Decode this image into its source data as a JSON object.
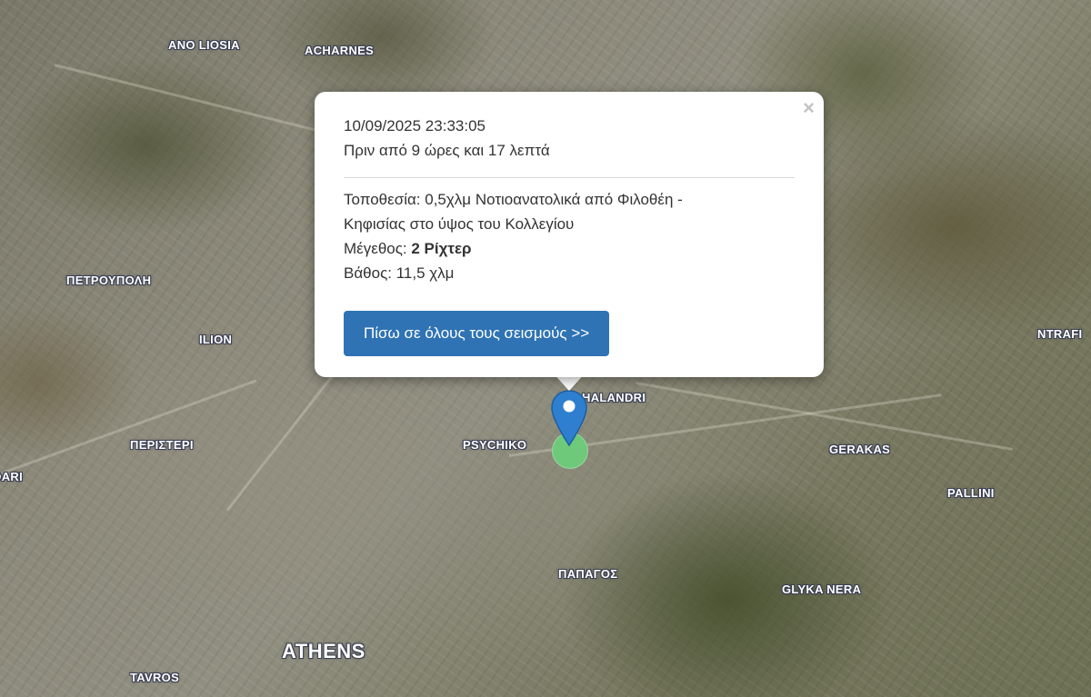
{
  "popup": {
    "datetime": "10/09/2025 23:33:05",
    "ago": "Πριν από 9 ώρες και 17 λεπτά",
    "location_line1": "Τοποθεσία: 0,5χλμ Νοτιοανατολικά από Φιλοθέη -",
    "location_line2": "Κηφισίας στο ύψος του Κολλεγίου",
    "magnitude_label": "Μέγεθος: ",
    "magnitude_value": "2 Ρίχτερ",
    "depth": "Βάθος: 11,5 χλμ",
    "back_button": "Πίσω σε όλους τους σεισμούς >>",
    "close": "×"
  },
  "map": {
    "places": [
      "ANO LIOSIA",
      "ACHARNES",
      "ΠΕΤΡΟΥΠΟΛΗ",
      "ILION",
      "ΠΕΡΙΣΤΕΡΙ",
      "DARI",
      "PSYCHIKO",
      "HALANDRI",
      "GERAKAS",
      "PALLINI",
      "NTRAFI",
      "ΠΑΠΑΓΟΣ",
      "GLYKA NERA",
      "ATHENS",
      "TAVROS"
    ]
  },
  "colors": {
    "button": "#2f73b4",
    "marker": "#2f7fd0",
    "quake_dot": "#6ec97a"
  }
}
